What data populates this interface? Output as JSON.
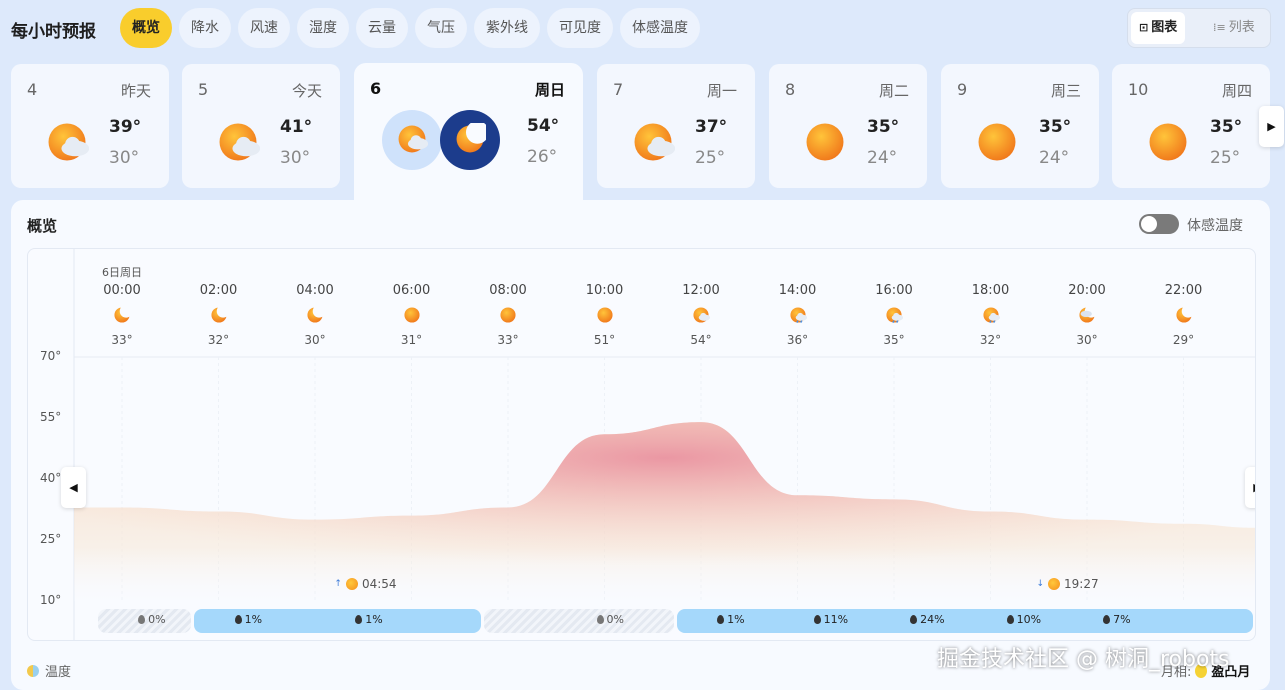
{
  "header": {
    "title": "每小时预报",
    "tabs": [
      {
        "label": "概览",
        "active": true
      },
      {
        "label": "降水"
      },
      {
        "label": "风速"
      },
      {
        "label": "湿度"
      },
      {
        "label": "云量"
      },
      {
        "label": "气压"
      },
      {
        "label": "紫外线"
      },
      {
        "label": "可见度"
      },
      {
        "label": "体感温度"
      }
    ],
    "view_toggle": {
      "chart_label": "图表",
      "list_label": "列表",
      "selected": "图表"
    }
  },
  "days": [
    {
      "num": "4",
      "name": "昨天",
      "high": "39°",
      "low": "30°",
      "icon": "sun-cloud-icon"
    },
    {
      "num": "5",
      "name": "今天",
      "high": "41°",
      "low": "30°",
      "icon": "sun-cloud-icon"
    },
    {
      "num": "6",
      "name": "周日",
      "high": "54°",
      "low": "26°",
      "icon": "day-night-icon",
      "selected": true
    },
    {
      "num": "7",
      "name": "周一",
      "high": "37°",
      "low": "25°",
      "icon": "sun-cloud-icon"
    },
    {
      "num": "8",
      "name": "周二",
      "high": "35°",
      "low": "24°",
      "icon": "sun-icon"
    },
    {
      "num": "9",
      "name": "周三",
      "high": "35°",
      "low": "24°",
      "icon": "sun-icon"
    },
    {
      "num": "10",
      "name": "周四",
      "high": "35°",
      "low": "25°",
      "icon": "sun-icon"
    }
  ],
  "panel": {
    "title": "概览",
    "feels_like_label": "体感温度",
    "feels_like_on": false,
    "date_label": "6日周日",
    "legend_label": "温度",
    "moon_label": "月相:",
    "moon_value": "盈凸月",
    "watermark": "掘金技术社区 @ 树洞_robots"
  },
  "hours": [
    {
      "time": "00:00",
      "temp": "33°",
      "icon": "moon-icon"
    },
    {
      "time": "02:00",
      "temp": "32°",
      "icon": "moon-icon"
    },
    {
      "time": "04:00",
      "temp": "30°",
      "icon": "moon-icon"
    },
    {
      "time": "06:00",
      "temp": "31°",
      "icon": "sun-icon"
    },
    {
      "time": "08:00",
      "temp": "33°",
      "icon": "sun-icon"
    },
    {
      "time": "10:00",
      "temp": "51°",
      "icon": "sun-icon"
    },
    {
      "time": "12:00",
      "temp": "54°",
      "icon": "sun-cloud-icon"
    },
    {
      "time": "14:00",
      "temp": "36°",
      "icon": "sun-rain-icon"
    },
    {
      "time": "16:00",
      "temp": "35°",
      "icon": "sun-rain-icon"
    },
    {
      "time": "18:00",
      "temp": "32°",
      "icon": "sun-rain-icon"
    },
    {
      "time": "20:00",
      "temp": "30°",
      "icon": "moon-cloud-icon"
    },
    {
      "time": "22:00",
      "temp": "29°",
      "icon": "moon-icon"
    }
  ],
  "chart_data": {
    "type": "area",
    "x": [
      "00:00",
      "02:00",
      "04:00",
      "06:00",
      "08:00",
      "10:00",
      "12:00",
      "14:00",
      "16:00",
      "18:00",
      "20:00",
      "22:00"
    ],
    "series": [
      {
        "values": [
          33,
          32,
          30,
          31,
          33,
          51,
          54,
          36,
          35,
          32,
          30,
          29
        ]
      }
    ],
    "ylim": [
      10,
      70
    ],
    "yticks": [
      "70°",
      "55°",
      "40°",
      "25°",
      "10°"
    ],
    "ytick_values": [
      70,
      55,
      40,
      25,
      10
    ],
    "grid": true
  },
  "sun": {
    "sunrise": "04:54",
    "sunset": "19:27"
  },
  "precipitation": {
    "segments": [
      {
        "type": "none",
        "from": "00:00",
        "to": "02:00"
      },
      {
        "type": "rain",
        "from": "02:00",
        "to": "08:00"
      },
      {
        "type": "none",
        "from": "08:00",
        "to": "12:00"
      },
      {
        "type": "rain",
        "from": "12:00",
        "to": "24:00"
      }
    ],
    "labels": [
      {
        "time": "00:30",
        "value": "0%",
        "dim": true
      },
      {
        "time": "02:30",
        "value": "1%"
      },
      {
        "time": "05:00",
        "value": "1%"
      },
      {
        "time": "10:00",
        "value": "0%",
        "dim": true
      },
      {
        "time": "12:30",
        "value": "1%"
      },
      {
        "time": "14:30",
        "value": "11%"
      },
      {
        "time": "16:30",
        "value": "24%"
      },
      {
        "time": "18:30",
        "value": "10%"
      },
      {
        "time": "20:30",
        "value": "7%"
      }
    ]
  }
}
